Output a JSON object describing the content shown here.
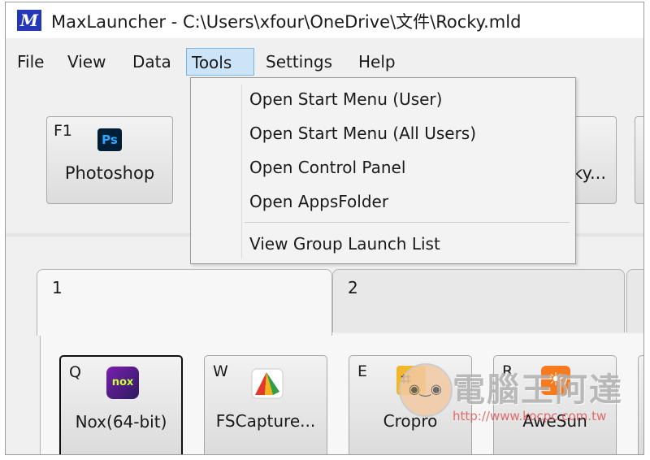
{
  "window": {
    "app_logo": "M",
    "title": "MaxLauncher - C:\\Users\\xfour\\OneDrive\\文件\\Rocky.mld"
  },
  "menubar": {
    "items": [
      "File",
      "View",
      "Data",
      "Tools",
      "Settings",
      "Help"
    ],
    "active": "Tools"
  },
  "top_buttons": [
    {
      "key": "F1",
      "icon": "photoshop-icon",
      "icon_text": "Ps",
      "label": "Photoshop"
    },
    {
      "label": "ky..."
    }
  ],
  "tools_menu": {
    "items": [
      "Open Start Menu (User)",
      "Open Start Menu (All Users)",
      "Open Control Panel",
      "Open AppsFolder"
    ],
    "extra": "View Group Launch List"
  },
  "tabs": [
    {
      "label": "1"
    },
    {
      "label": "2"
    }
  ],
  "group_buttons": [
    {
      "key": "Q",
      "icon": "nox-icon",
      "icon_text": "nox",
      "label": "Nox(64-bit)"
    },
    {
      "key": "W",
      "icon": "fscapture-icon",
      "label": "FSCapture..."
    },
    {
      "key": "E",
      "icon": "cropro-icon",
      "label": "Cropro"
    },
    {
      "key": "R",
      "icon": "awesun-icon",
      "label": "AweSun"
    }
  ],
  "watermark": {
    "text": "電腦王阿達",
    "url": "http://www.kocpc.com.tw"
  },
  "colors": {
    "menu_highlight": "#cce4f7",
    "menu_highlight_border": "#7ab4e3",
    "logo": "#2437b8"
  }
}
